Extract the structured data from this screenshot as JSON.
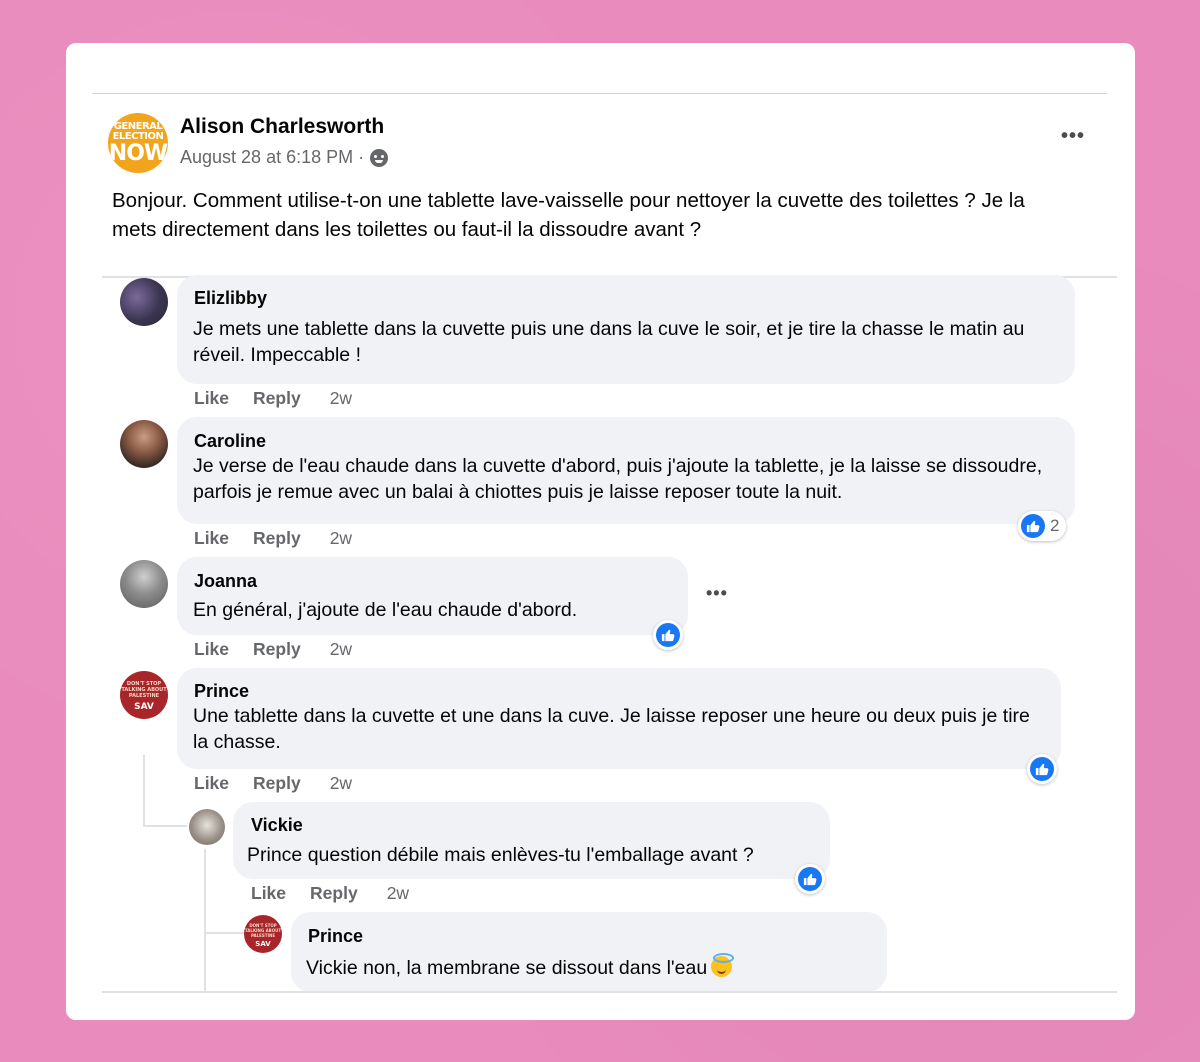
{
  "post": {
    "avatar_lines": [
      "GENERAL",
      "ELECTION",
      "NOW"
    ],
    "author": "Alison Charlesworth",
    "timestamp": "August 28 at 6:18 PM ·",
    "audience_icon": "friends-icon",
    "menu": "•••",
    "text": "Bonjour. Comment utilise-t-on une tablette lave-vaisselle pour nettoyer la cuvette des toilettes ? Je la mets directement dans les toilettes ou faut-il la dissoudre avant ?"
  },
  "actions": {
    "like": "Like",
    "reply": "Reply"
  },
  "comments": [
    {
      "author": "Elizlibby",
      "text": "Je mets une tablette dans la cuvette puis une dans la cuve le soir, et je tire la chasse le matin au réveil. Impeccable !",
      "time": "2w"
    },
    {
      "author": "Caroline",
      "text": "Je verse de l'eau chaude dans la cuvette d'abord, puis j'ajoute la tablette, je la laisse se dissoudre, parfois je remue avec un balai à chiottes puis je laisse reposer toute la nuit.",
      "time": "2w",
      "reaction_count": "2"
    },
    {
      "author": "Joanna",
      "text": "En général, j'ajoute de l'eau chaude d'abord.",
      "time": "2w",
      "menu": "•••"
    },
    {
      "author": "Prince",
      "avatar_text": "DON'T STOP TALKING ABOUT PALESTINE",
      "avatar_sub": "SAV",
      "text": "Une tablette dans la cuvette et une dans la cuve. Je laisse reposer une heure ou deux puis je tire la chasse.",
      "time": "2w"
    },
    {
      "author": "Vickie",
      "mention": "Prince",
      "text": " question débile mais enlèves-tu l'emballage avant ?",
      "time": "2w"
    },
    {
      "author": "Prince",
      "mention": "Vickie",
      "text": " non, la membrane se dissout dans l'eau",
      "emoji": "smiling-face-with-halo-icon"
    }
  ],
  "colors": {
    "background": "#e98bbd",
    "bubble": "#f0f2f5",
    "like_blue": "#1877f2",
    "muted": "#65676b"
  }
}
